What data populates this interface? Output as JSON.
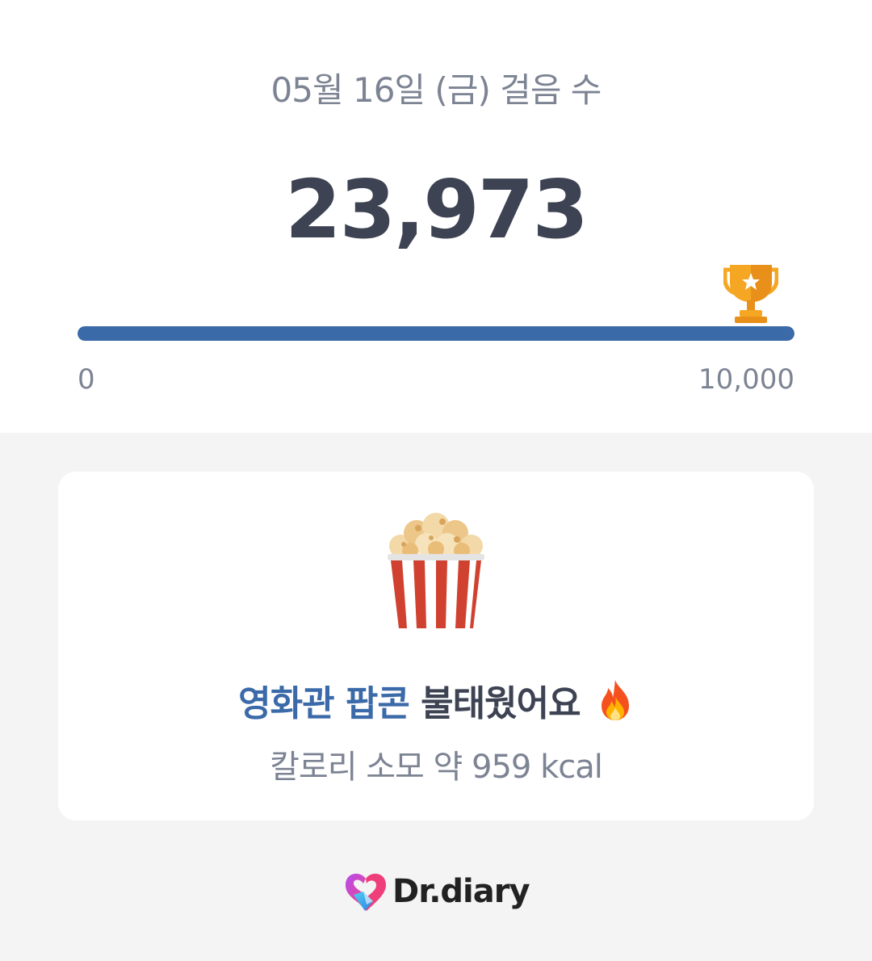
{
  "header": {
    "date_title": "05월 16일 (금) 걸음 수",
    "step_count": "23,973"
  },
  "progress": {
    "fraction": 1.0,
    "min_label": "0",
    "max_label": "10,000",
    "fill_color": "#3b6aa9",
    "goal_icon": "trophy-icon"
  },
  "card": {
    "illustration": "popcorn-icon",
    "headline_highlight": "영화관 팝콘",
    "headline_rest": " 불태웠어요",
    "headline_icon": "fire-icon",
    "calorie_text": "칼로리 소모 약 959 kcal"
  },
  "footer": {
    "brand_name": "Dr.diary"
  }
}
